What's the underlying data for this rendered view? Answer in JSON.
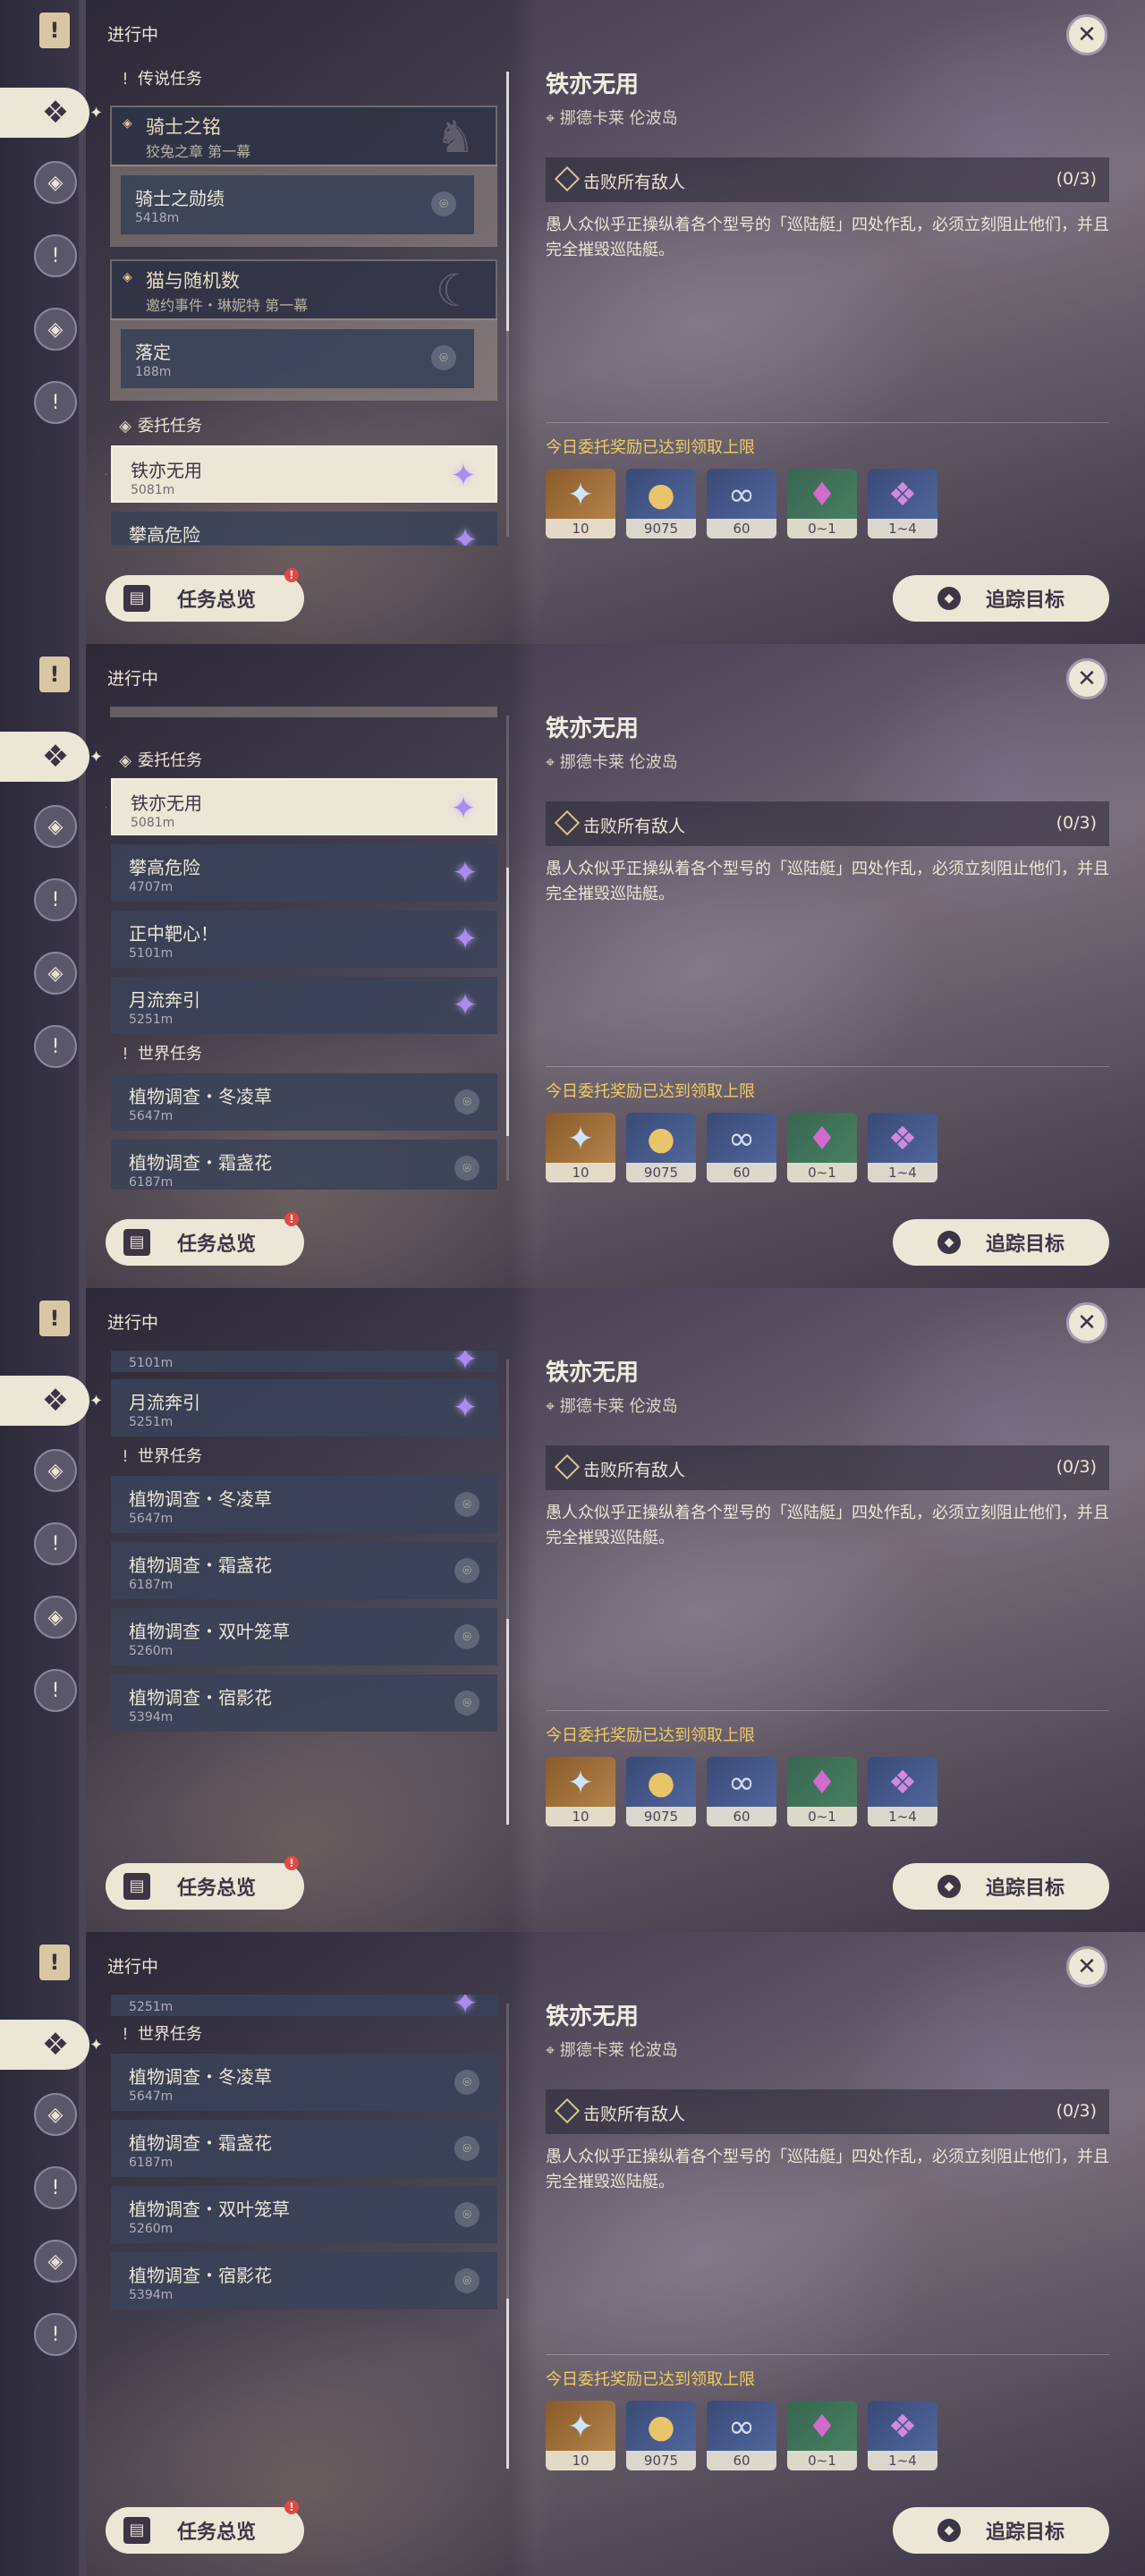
{
  "panel_title": "进行中",
  "sections": {
    "legend": "传说任务",
    "commission": "委托任务",
    "world": "世界任务"
  },
  "legend_quests": [
    {
      "title": "骑士之铭",
      "subtitle": "狡兔之章 第一幕",
      "step": "骑士之勋绩",
      "distance": "5418m"
    },
    {
      "title": "猫与随机数",
      "subtitle": "邀约事件・琳妮特 第一幕",
      "step": "落定",
      "distance": "188m"
    }
  ],
  "commissions": [
    {
      "title": "铁亦无用",
      "distance": "5081m"
    },
    {
      "title": "攀高危险",
      "distance": "4707m"
    },
    {
      "title": "正中靶心！",
      "distance": "5101m"
    },
    {
      "title": "月流奔引",
      "distance": "5251m"
    }
  ],
  "world_quests": [
    {
      "title": "植物调查・冬凌草",
      "distance": "5647m"
    },
    {
      "title": "植物调查・霜盏花",
      "distance": "6187m"
    },
    {
      "title": "植物调查・双叶笼草",
      "distance": "5260m"
    },
    {
      "title": "植物调查・宿影花",
      "distance": "5394m"
    }
  ],
  "detail": {
    "title": "铁亦无用",
    "location": "挪德卡莱 伦波岛",
    "objective": "击败所有敌人",
    "progress": "(0/3)",
    "description": "愚人众似乎正操纵着各个型号的「巡陆艇」四处作乱，必须立刻阻止他们，并且完全摧毁巡陆艇。",
    "reward_note": "今日委托奖励已达到领取上限",
    "rewards": [
      {
        "icon": "star-icon",
        "qty": "10",
        "color": "#9a6a38"
      },
      {
        "icon": "mora-coin-icon",
        "qty": "9075",
        "color": "#4a5a8c"
      },
      {
        "icon": "fetters-icon",
        "qty": "60",
        "color": "#4a5a8c"
      },
      {
        "icon": "crystal-icon",
        "qty": "0~1",
        "color": "#42725a"
      },
      {
        "icon": "crystal-cluster-icon",
        "qty": "1~4",
        "color": "#4a5a8c"
      }
    ]
  },
  "buttons": {
    "overview": "任务总览",
    "track": "追踪目标",
    "close": "✕"
  },
  "colors": {
    "accent_cream": "#ece6d6",
    "reward_note": "#f0cd62",
    "gem_purple": "#a88cf0",
    "notify_red": "#e04a42"
  },
  "scroll_progress": [
    0.0,
    0.35,
    0.72,
    1.0
  ]
}
